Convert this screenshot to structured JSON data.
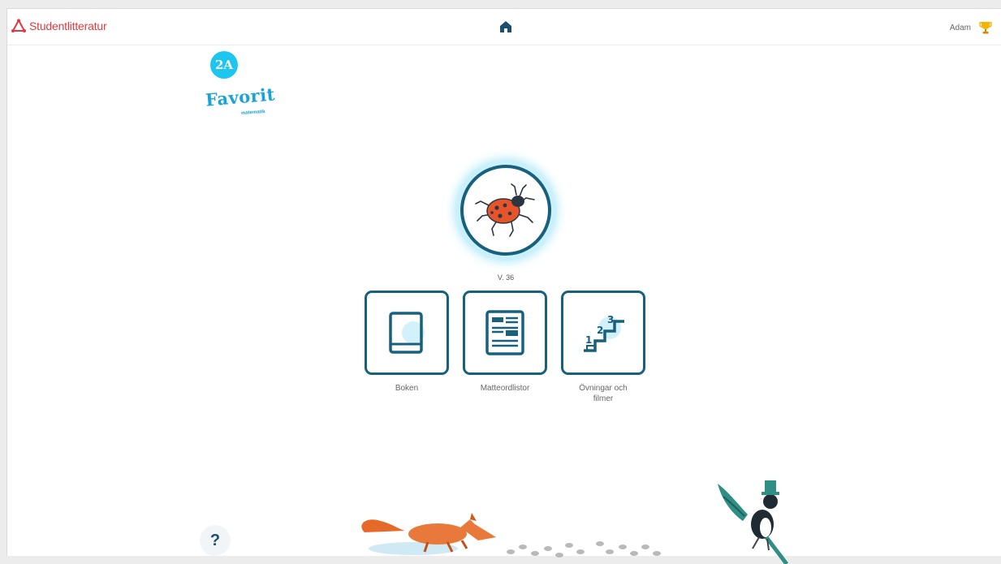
{
  "header": {
    "brand_name": "Studentlitteratur",
    "home_icon": "home-icon",
    "user_name": "Adam",
    "trophy_icon": "trophy-icon"
  },
  "series": {
    "grade": "2A",
    "title": "Favorit",
    "subtitle": "matematik"
  },
  "week": {
    "label": "V. 36",
    "icon": "ladybug-icon"
  },
  "tiles": [
    {
      "label": "Boken",
      "icon": "book-icon"
    },
    {
      "label": "Matteordlistor",
      "icon": "word-list-icon"
    },
    {
      "label": "Övningar och\nfilmer",
      "icon": "stairs-123-icon"
    }
  ],
  "help": {
    "label": "?"
  },
  "colors": {
    "brand_red": "#e0393e",
    "accent_blue": "#1ec6ef",
    "tile_border": "#17607e"
  }
}
